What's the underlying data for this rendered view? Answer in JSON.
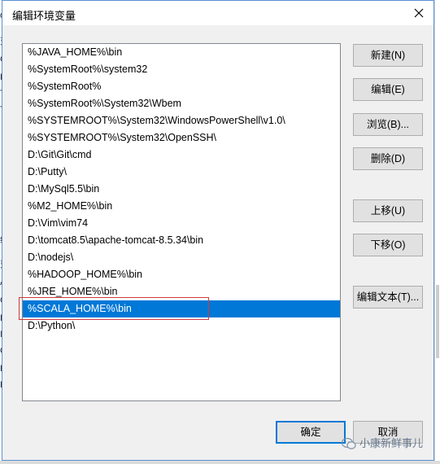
{
  "dialog": {
    "title": "编辑环境变量",
    "entries": [
      "%JAVA_HOME%\\bin",
      "%SystemRoot%\\system32",
      "%SystemRoot%",
      "%SystemRoot%\\System32\\Wbem",
      "%SYSTEMROOT%\\System32\\WindowsPowerShell\\v1.0\\",
      "%SYSTEMROOT%\\System32\\OpenSSH\\",
      "D:\\Git\\Git\\cmd",
      "D:\\Putty\\",
      "D:\\MySql5.5\\bin",
      "%M2_HOME%\\bin",
      "D:\\Vim\\vim74",
      "D:\\tomcat8.5\\apache-tomcat-8.5.34\\bin",
      "D:\\nodejs\\",
      "%HADOOP_HOME%\\bin",
      "%JRE_HOME%\\bin",
      "%SCALA_HOME%\\bin",
      "D:\\Python\\"
    ],
    "selected_index": 15,
    "buttons": {
      "new": "新建(N)",
      "edit": "编辑(E)",
      "browse": "浏览(B)...",
      "delete": "删除(D)",
      "move_up": "上移(U)",
      "move_down": "下移(O)",
      "edit_text": "编辑文本(T)..."
    },
    "ok": "确定",
    "cancel": "取消"
  },
  "background": {
    "left_chars": [
      "o",
      "变",
      "C",
      "Pa",
      "TE",
      "TM",
      "统",
      "变",
      "A",
      "C",
      "D",
      "N",
      "O",
      "Pa",
      "PA"
    ]
  },
  "watermark": "小康新鲜事儿",
  "colors": {
    "selection": "#0078d7",
    "highlight": "#d23a3a"
  }
}
